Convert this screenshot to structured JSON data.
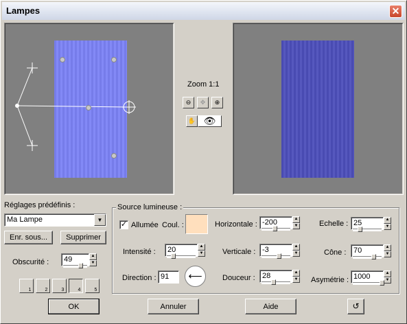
{
  "window": {
    "title": "Lampes",
    "close_icon": "close-icon"
  },
  "preview": {
    "zoom_label": "Zoom 1:1",
    "left_canvas_color": "#7c83f6",
    "right_canvas_color": "#4d4fbb",
    "bg_color": "#808080"
  },
  "presets": {
    "label": "Réglages prédéfinis :",
    "selected": "Ma Lampe",
    "save_as": "Enr. sous...",
    "delete": "Supprimer",
    "darkness_label": "Obscurité :",
    "darkness_value": "49",
    "lamp_buttons": [
      "1",
      "2",
      "3",
      "4",
      "5"
    ]
  },
  "source": {
    "group_label": "Source lumineuse :",
    "on_label": "Allumée",
    "on_checked": true,
    "color_label": "Coul. :",
    "color_value": "#ffdfbd",
    "intensity_label": "Intensité :",
    "intensity_value": "20",
    "direction_label": "Direction :",
    "direction_value": "91",
    "horizontal_label": "Horizontale :",
    "horizontal_value": "-200",
    "vertical_label": "Verticale :",
    "vertical_value": "-3",
    "softness_label": "Douceur :",
    "softness_value": "28",
    "scale_label": "Echelle :",
    "scale_value": "25",
    "cone_label": "Cône :",
    "cone_value": "70",
    "asymmetry_label": "Asymétrie :",
    "asymmetry_value": "1000"
  },
  "footer": {
    "ok": "OK",
    "cancel": "Annuler",
    "help": "Aide"
  }
}
